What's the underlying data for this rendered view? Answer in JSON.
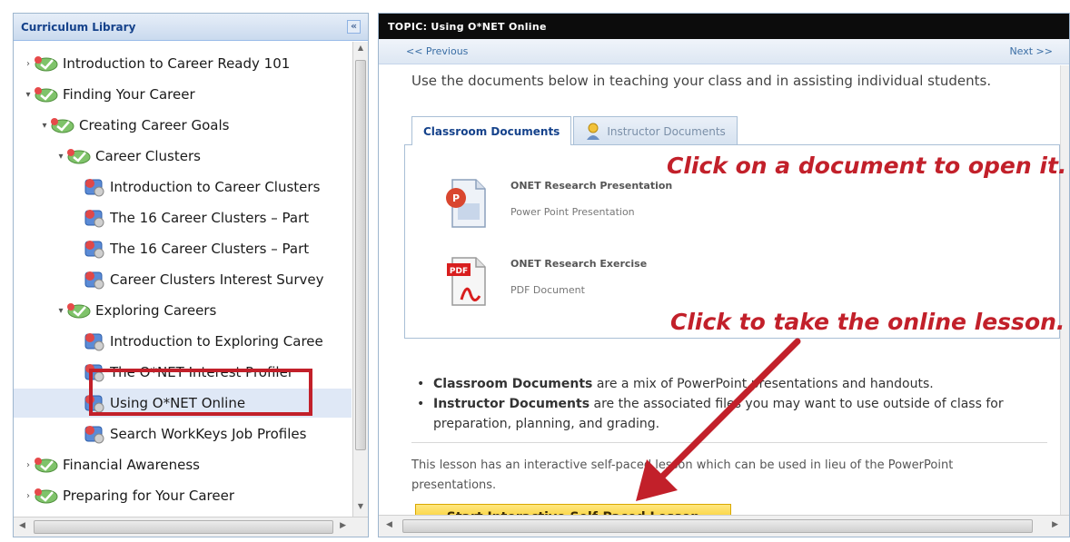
{
  "left_panel": {
    "title": "Curriculum Library",
    "collapse_icon": "«",
    "tree": [
      {
        "label": "Introduction to Career Ready 101",
        "icon": "check-icon",
        "expander": "›"
      },
      {
        "label": "Finding Your Career",
        "icon": "check-icon",
        "expander": "▾"
      },
      {
        "label": "Creating Career Goals",
        "icon": "check-icon",
        "expander": "▾"
      },
      {
        "label": "Career Clusters",
        "icon": "check-icon",
        "expander": "▾"
      },
      {
        "label": "Introduction to Career Clusters",
        "icon": "lesson-icon"
      },
      {
        "label": "The 16 Career Clusters – Part",
        "icon": "lesson-icon"
      },
      {
        "label": "The 16 Career Clusters – Part",
        "icon": "lesson-icon"
      },
      {
        "label": "Career Clusters Interest Survey",
        "icon": "lesson-icon"
      },
      {
        "label": "Exploring Careers",
        "icon": "check-icon",
        "expander": "▾"
      },
      {
        "label": "Introduction to Exploring Caree",
        "icon": "lesson-icon"
      },
      {
        "label": "The O*NET Interest Profiler",
        "icon": "lesson-icon"
      },
      {
        "label": "Using O*NET Online",
        "icon": "lesson-icon",
        "selected": true
      },
      {
        "label": "Search WorkKeys Job Profiles",
        "icon": "lesson-icon"
      },
      {
        "label": "Financial Awareness",
        "icon": "check-icon",
        "expander": "›"
      },
      {
        "label": "Preparing for Your Career",
        "icon": "check-icon",
        "expander": "›"
      }
    ]
  },
  "right_panel": {
    "header": "TOPIC: Using O*NET Online",
    "prev": "<< Previous",
    "next": "Next >>",
    "intro": "Use the documents below in teaching your class and in assisting individual students.",
    "tabs": {
      "classroom": "Classroom Documents",
      "instructor": "Instructor Documents"
    },
    "documents": [
      {
        "name": "ONET Research Presentation",
        "type": "Power Point Presentation",
        "icon": "powerpoint-icon"
      },
      {
        "name": "ONET Research Exercise",
        "type": "PDF Document",
        "icon": "pdf-icon"
      }
    ],
    "bullets": [
      {
        "bold": "Classroom Documents",
        "text": " are a mix of PowerPoint presentations and handouts."
      },
      {
        "bold": "Instructor Documents",
        "text": " are the associated files you may want to use outside of class for preparation, planning, and grading."
      }
    ],
    "lesson_text": "This lesson has an interactive self-paced lesson which can be used in lieu of the PowerPoint presentations.",
    "start_button": "Start Interactive Self-Paced Lesson"
  },
  "annotations": {
    "open_doc": "Click on a document to open it.",
    "take_lesson": "Click to take the online lesson."
  },
  "colors": {
    "accent_red": "#c2202a",
    "header_black": "#0c0c0c",
    "button_yellow": "#f5c400",
    "tree_title_blue": "#15428b"
  }
}
